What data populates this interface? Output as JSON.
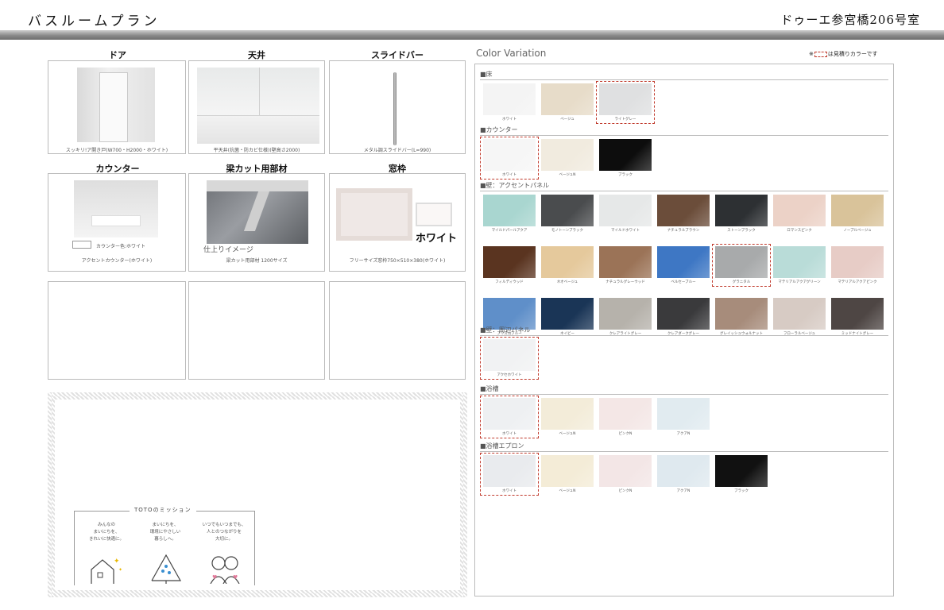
{
  "header": {
    "title": "バスルームプラン",
    "room": "ドゥーエ参宮橋206号室"
  },
  "items": {
    "door": {
      "title": "ドア",
      "caption": "スッキリ!ア開き戸(W700・H2000・ホワイト)"
    },
    "ceiling": {
      "title": "天井",
      "caption": "平天井(抗菌・防カビ仕様)(壁高さ2000)"
    },
    "slide_bar": {
      "title": "スライドバー",
      "caption": "メタル調スライドバー(L=990)"
    },
    "counter": {
      "title": "カウンター",
      "swatch_note": "カウンター色:ホワイト",
      "caption": "アクセントカウンター(ホワイト)"
    },
    "beam_cut": {
      "title": "梁カット用部材",
      "finish_note": "仕上りイメージ",
      "caption": "梁カット用部材 1200サイズ"
    },
    "window_frame": {
      "title": "窓枠",
      "color_label": "ホワイト",
      "caption": "フリーサイズ窓枠750×510×380(ホワイト)"
    }
  },
  "mission": {
    "title": "TOTOのミッション",
    "texts": [
      "みんなの\nまいにちを、\nきれいに快適に。",
      "まいにちを、\n環境にやさしい\n暮らしへ。",
      "いつでもいつまでも、\n人とのつながりを\n大切に。"
    ]
  },
  "color_variation": {
    "heading": "Color Variation",
    "note_prefix": "※",
    "note_suffix": "は見積りカラーです",
    "sections": [
      {
        "label": "■床",
        "swatches": [
          {
            "name": "ホワイト",
            "color": "#f4f4f4",
            "selected": false
          },
          {
            "name": "ベージュ",
            "color": "#e7dcc9",
            "selected": false
          },
          {
            "name": "ライトグレー",
            "color": "#dfe0e1",
            "selected": true
          }
        ]
      },
      {
        "label": "■カウンター",
        "swatches": [
          {
            "name": "ホワイト",
            "color": "#f6f6f6",
            "selected": true
          },
          {
            "name": "ベージュN",
            "color": "#f1ebdf",
            "selected": false
          },
          {
            "name": "ブラック",
            "color": "#0d0d0d",
            "selected": false
          }
        ]
      },
      {
        "label": "■壁：アクセントパネル",
        "swatches": [
          {
            "name": "マイルドパールアクア",
            "color": "#a9d6d0",
            "selected": false
          },
          {
            "name": "モノトーンブラック",
            "color": "#4a4c4e",
            "selected": false
          },
          {
            "name": "マイルドホワイト",
            "color": "#e6e8e8",
            "selected": false
          },
          {
            "name": "ナチュラルブラウン",
            "color": "#6b4d3a",
            "selected": false
          },
          {
            "name": "ストーンブラック",
            "color": "#2d3033",
            "selected": false
          },
          {
            "name": "ロマンスピンク",
            "color": "#ecd2c7",
            "selected": false
          },
          {
            "name": "ノーブルベージュ",
            "color": "#d9c39a",
            "selected": false
          },
          {
            "name": "フィルディウッド",
            "color": "#5a3420",
            "selected": false
          },
          {
            "name": "ネオベージュ",
            "color": "#e5c99c",
            "selected": false
          },
          {
            "name": "ナチュラルグレーウッド",
            "color": "#9b7357",
            "selected": false
          },
          {
            "name": "ベルセーブルー",
            "color": "#3e77c4",
            "selected": false
          },
          {
            "name": "グラニタル",
            "color": "#a8aaab",
            "selected": true
          },
          {
            "name": "マテリアルアクアグリーン",
            "color": "#b9dcd8",
            "selected": false
          },
          {
            "name": "マテリアルアクアピンク",
            "color": "#e7ccc6",
            "selected": false
          },
          {
            "name": "プリズムブルー",
            "color": "#5f8fc9",
            "selected": false
          },
          {
            "name": "ネイビー",
            "color": "#1a3556",
            "selected": false
          },
          {
            "name": "クレアライトグレー",
            "color": "#b6b2ab",
            "selected": false
          },
          {
            "name": "クレアダークグレー",
            "color": "#3a3a3c",
            "selected": false
          },
          {
            "name": "グレイッシュウォルナット",
            "color": "#a78c7b",
            "selected": false
          },
          {
            "name": "フローラルベージュ",
            "color": "#d7cbc4",
            "selected": false
          },
          {
            "name": "ミッドナイトグレー",
            "color": "#4e4644",
            "selected": false
          }
        ]
      },
      {
        "label": "■壁：周辺パネル",
        "swatches": [
          {
            "name": "アクセホワイト",
            "color": "#f1f2f3",
            "selected": true
          }
        ]
      },
      {
        "label": "■浴槽",
        "swatches": [
          {
            "name": "ホワイト",
            "color": "#eef0f2",
            "selected": true
          },
          {
            "name": "ベージュN",
            "color": "#f3ecd9",
            "selected": false
          },
          {
            "name": "ピンクN",
            "color": "#f4e7e6",
            "selected": false
          },
          {
            "name": "アクアN",
            "color": "#e1ebf0",
            "selected": false
          }
        ]
      },
      {
        "label": "■浴槽エプロン",
        "swatches": [
          {
            "name": "ホワイト",
            "color": "#e9ebee",
            "selected": true
          },
          {
            "name": "ベージュN",
            "color": "#f4ecd7",
            "selected": false
          },
          {
            "name": "ピンクN",
            "color": "#f3e6e6",
            "selected": false
          },
          {
            "name": "アクアN",
            "color": "#dfe9ef",
            "selected": false
          },
          {
            "name": "ブラック",
            "color": "#111111",
            "selected": false
          }
        ]
      }
    ]
  }
}
